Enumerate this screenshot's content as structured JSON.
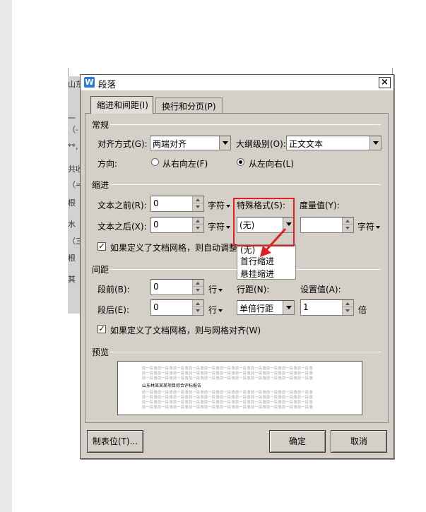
{
  "document": {
    "marks": [
      "山东",
      "一",
      "（-",
      "**,",
      "共收",
      "（=",
      "根",
      "水",
      "（三",
      "根",
      "其"
    ]
  },
  "dialog": {
    "title": "段落",
    "icon_letter": "W",
    "close_symbol": "×",
    "tabs": [
      {
        "label": "缩进和间距(I)",
        "active": true
      },
      {
        "label": "换行和分页(P)",
        "active": false
      }
    ],
    "general": {
      "heading": "常规",
      "alignment_label": "对齐方式(G):",
      "alignment_value": "两端对齐",
      "outline_label": "大纲级别(O):",
      "outline_value": "正文文本",
      "direction_label": "方向:",
      "rtl_label": "从右向左(F)",
      "ltr_label": "从左向右(L)"
    },
    "indent": {
      "heading": "缩进",
      "before_label": "文本之前(R):",
      "before_value": "0",
      "after_label": "文本之后(X):",
      "after_value": "0",
      "unit": "字符",
      "special_label": "特殊格式(S):",
      "special_value": "(无)",
      "measure_label": "度量值(Y):",
      "measure_value": "",
      "measure_unit": "字符",
      "grid_check_label": "如果定义了文档网格，则自动调整",
      "dropdown_options": [
        "(无)",
        "首行缩进",
        "悬挂缩进"
      ]
    },
    "spacing": {
      "heading": "间距",
      "before_label": "段前(B):",
      "before_value": "0",
      "after_label": "段后(E):",
      "after_value": "0",
      "unit": "行",
      "line_label": "行距(N):",
      "line_value": "单倍行距",
      "setting_label": "设置值(A):",
      "setting_value": "1",
      "setting_unit": "倍",
      "grid_check_label": "如果定义了文档网格，则与网格对齐(W)"
    },
    "preview": {
      "heading": "预览",
      "sample_text": "山东林某某某项目综合评标报告",
      "filler": "前一段落前一段落前一段落前一段落前一段落前一段落前一段落前一段落前一段落前一段落前一段落"
    },
    "buttons": {
      "tabs": "制表位(T)...",
      "ok": "确定",
      "cancel": "取消"
    }
  },
  "annotation_color": "#e02020"
}
